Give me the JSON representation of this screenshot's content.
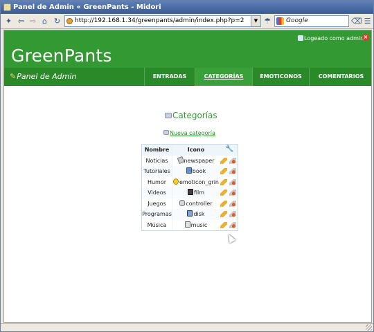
{
  "window": {
    "title": "Panel de Admin « GreenPants - Midori"
  },
  "browser": {
    "url": "http://192.168.1.34/greenpants/admin/index.php?p=2",
    "search_placeholder": "Google"
  },
  "site": {
    "title": "GreenPants",
    "logged_in_text": "Logeado como admin",
    "panel_label": "Panel de Admin"
  },
  "nav": {
    "items": [
      {
        "label": "ENTRADAS"
      },
      {
        "label": "CATEGORÍAS"
      },
      {
        "label": "EMOTICONOS"
      },
      {
        "label": "COMENTARIOS"
      }
    ],
    "active_index": 1
  },
  "main": {
    "heading": "Categorías",
    "new_category_link": "Nueva categoría",
    "table": {
      "headers": [
        "Nombre",
        "Icono"
      ],
      "rows": [
        {
          "name": "Noticias",
          "icon": "newspaper"
        },
        {
          "name": "Tutoriales",
          "icon": "book"
        },
        {
          "name": "Humor",
          "icon": "emoticon_grin"
        },
        {
          "name": "Videos",
          "icon": "film"
        },
        {
          "name": "Juegos",
          "icon": "controller"
        },
        {
          "name": "Programas",
          "icon": "disk"
        },
        {
          "name": "Música",
          "icon": "music"
        }
      ]
    }
  },
  "colors": {
    "header_green": "#339933",
    "nav_green": "#2a8a2a",
    "link_green": "#2e8b2e"
  }
}
